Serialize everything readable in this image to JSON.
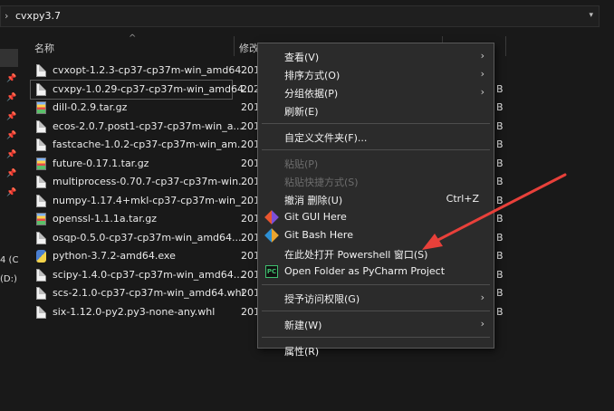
{
  "address": {
    "path": "cvxpy3.7"
  },
  "nav": {
    "drives": [
      {
        "label": "4 (C"
      },
      {
        "label": "(D:)"
      }
    ]
  },
  "columns": {
    "name": "名称",
    "date": "修改"
  },
  "files": [
    {
      "name": "cvxopt-1.2.3-cp37-cp37m-win_amd64...",
      "date": "201",
      "size": "",
      "icon": "document-icon"
    },
    {
      "name": "cvxpy-1.0.29-cp37-cp37m-win_amd64...",
      "date": "202",
      "size": "B",
      "icon": "document-icon",
      "selected": true
    },
    {
      "name": "dill-0.2.9.tar.gz",
      "date": "201",
      "size": "B",
      "icon": "archive-icon"
    },
    {
      "name": "ecos-2.0.7.post1-cp37-cp37m-win_a...",
      "date": "201",
      "size": "B",
      "icon": "document-icon"
    },
    {
      "name": "fastcache-1.0.2-cp37-cp37m-win_am...",
      "date": "201",
      "size": "B",
      "icon": "document-icon"
    },
    {
      "name": "future-0.17.1.tar.gz",
      "date": "201",
      "size": "B",
      "icon": "archive-icon"
    },
    {
      "name": "multiprocess-0.70.7-cp37-cp37m-win...",
      "date": "201",
      "size": "B",
      "icon": "document-icon"
    },
    {
      "name": "numpy-1.17.4+mkl-cp37-cp37m-win_...",
      "date": "201",
      "size": "B",
      "icon": "document-icon"
    },
    {
      "name": "openssl-1.1.1a.tar.gz",
      "date": "201",
      "size": "B",
      "icon": "archive-icon"
    },
    {
      "name": "osqp-0.5.0-cp37-cp37m-win_amd64....",
      "date": "201",
      "size": "B",
      "icon": "document-icon"
    },
    {
      "name": "python-3.7.2-amd64.exe",
      "date": "201",
      "size": "B",
      "icon": "python-installer-icon"
    },
    {
      "name": "scipy-1.4.0-cp37-cp37m-win_amd64....",
      "date": "201",
      "size": "B",
      "icon": "document-icon"
    },
    {
      "name": "scs-2.1.0-cp37-cp37m-win_amd64.whl",
      "date": "201",
      "size": "B",
      "icon": "document-icon"
    },
    {
      "name": "six-1.12.0-py2.py3-none-any.whl",
      "date": "201",
      "size": "B",
      "icon": "document-icon"
    }
  ],
  "context_menu": {
    "items": [
      {
        "label": "查看(V)",
        "submenu": true
      },
      {
        "label": "排序方式(O)",
        "submenu": true
      },
      {
        "label": "分组依据(P)",
        "submenu": true
      },
      {
        "label": "刷新(E)"
      },
      {
        "sep": true
      },
      {
        "label": "自定义文件夹(F)..."
      },
      {
        "sep": true
      },
      {
        "label": "粘贴(P)",
        "disabled": true
      },
      {
        "label": "粘贴快捷方式(S)",
        "disabled": true
      },
      {
        "label": "撤消 删除(U)",
        "shortcut": "Ctrl+Z"
      },
      {
        "label": "Git GUI Here",
        "icon": "git-gui-icon"
      },
      {
        "label": "Git Bash Here",
        "icon": "git-bash-icon"
      },
      {
        "label": "在此处打开 Powershell 窗口(S)"
      },
      {
        "label": "Open Folder as PyCharm Project",
        "icon": "pycharm-icon"
      },
      {
        "sep": true
      },
      {
        "label": "授予访问权限(G)",
        "submenu": true
      },
      {
        "sep": true
      },
      {
        "label": "新建(W)",
        "submenu": true
      },
      {
        "sep": true
      },
      {
        "label": "属性(R)"
      }
    ]
  },
  "colors": {
    "annotation_arrow": "#e8403a",
    "menu_bg": "#2b2b2b",
    "window_bg": "#191919"
  }
}
